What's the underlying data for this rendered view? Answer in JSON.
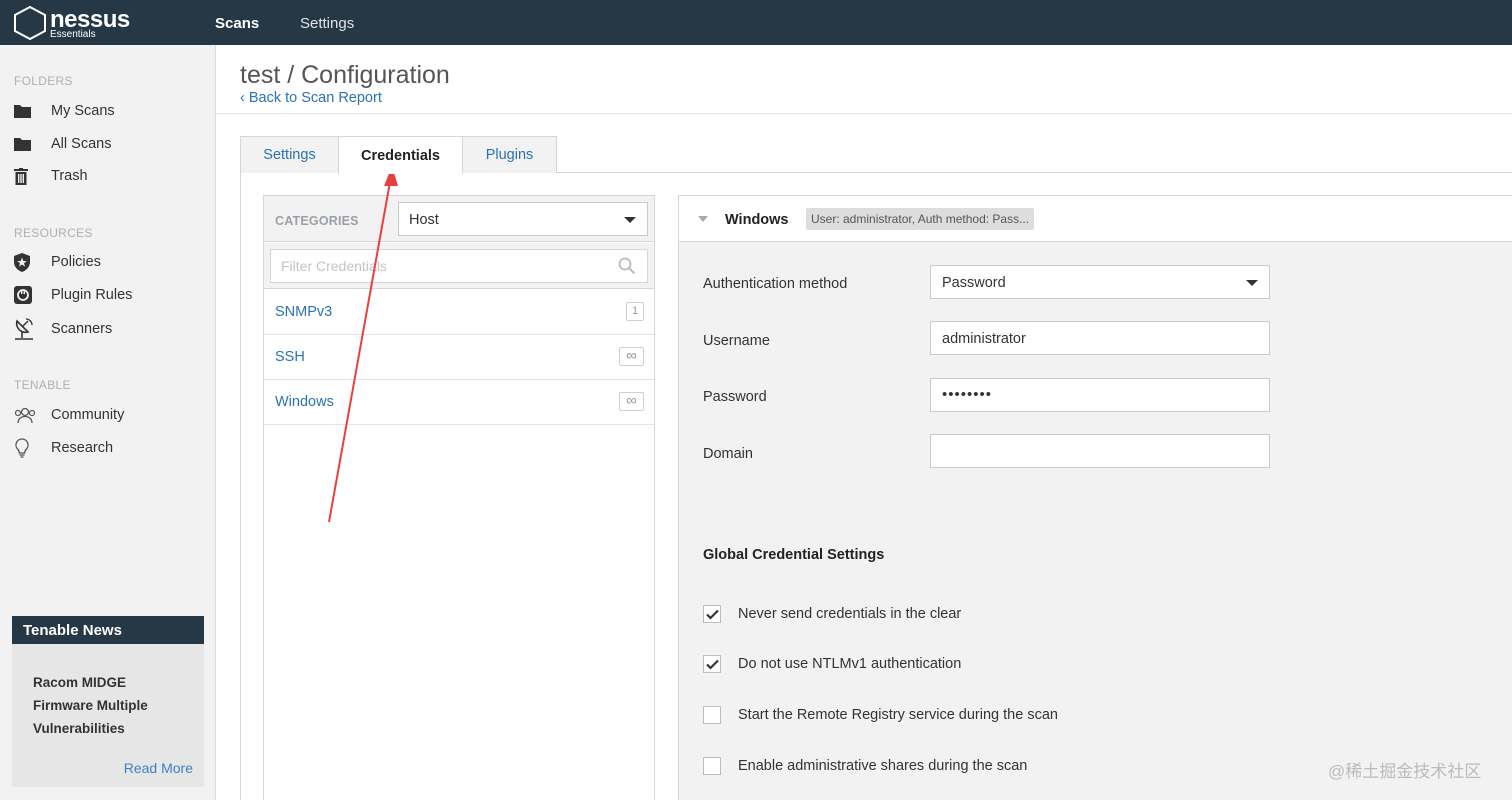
{
  "topbar": {
    "logo_name": "nessus",
    "logo_sub": "Essentials",
    "nav": [
      "Scans",
      "Settings"
    ]
  },
  "sidebar": {
    "folders_label": "FOLDERS",
    "folders": [
      {
        "label": "My Scans",
        "icon": "folder-icon"
      },
      {
        "label": "All Scans",
        "icon": "folder-icon"
      },
      {
        "label": "Trash",
        "icon": "trash-icon"
      }
    ],
    "resources_label": "RESOURCES",
    "resources": [
      {
        "label": "Policies",
        "icon": "shield-star-icon"
      },
      {
        "label": "Plugin Rules",
        "icon": "plugin-rules-icon"
      },
      {
        "label": "Scanners",
        "icon": "satellite-dish-icon"
      }
    ],
    "tenable_label": "TENABLE",
    "tenable": [
      {
        "label": "Community",
        "icon": "community-icon"
      },
      {
        "label": "Research",
        "icon": "lightbulb-icon"
      }
    ],
    "news": {
      "title": "Tenable News",
      "headline": "Racom MIDGE Firmware Multiple Vulnerabilities",
      "read_more": "Read More"
    }
  },
  "page": {
    "title": "test / Configuration",
    "back_link": "Back to Scan Report"
  },
  "tabs": [
    "Settings",
    "Credentials",
    "Plugins"
  ],
  "active_tab": "Credentials",
  "categories": {
    "label": "CATEGORIES",
    "selected": "Host",
    "filter_placeholder": "Filter Credentials",
    "items": [
      {
        "name": "SNMPv3",
        "count": "1"
      },
      {
        "name": "SSH",
        "count": "∞"
      },
      {
        "name": "Windows",
        "count": "∞"
      }
    ]
  },
  "windows": {
    "title": "Windows",
    "summary": "User: administrator, Auth method: Pass...",
    "auth_label": "Authentication method",
    "auth_value": "Password",
    "username_label": "Username",
    "username_value": "administrator",
    "password_label": "Password",
    "password_value": "••••••••",
    "domain_label": "Domain",
    "domain_value": ""
  },
  "global_settings": {
    "title": "Global Credential Settings",
    "options": [
      {
        "label": "Never send credentials in the clear",
        "checked": true
      },
      {
        "label": "Do not use NTLMv1 authentication",
        "checked": true
      },
      {
        "label": "Start the Remote Registry service during the scan",
        "checked": false
      },
      {
        "label": "Enable administrative shares during the scan",
        "checked": false
      }
    ]
  },
  "watermark": "@稀土掘金技术社区",
  "colors": {
    "topbar": "#263746",
    "link": "#2a72b5",
    "annotation_arrow": "#e8403d"
  }
}
